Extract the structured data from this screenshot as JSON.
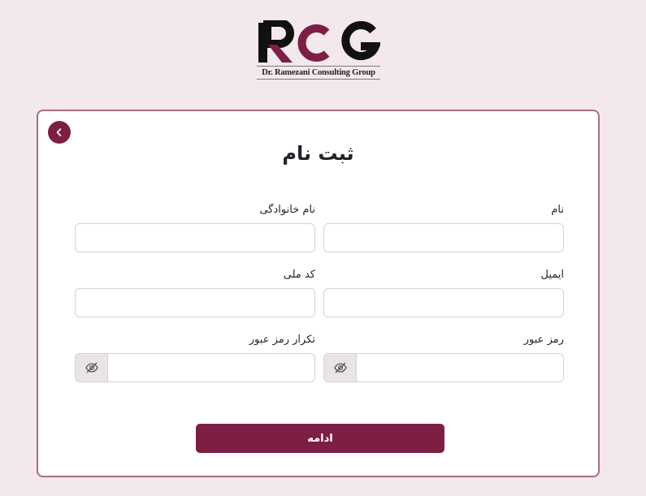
{
  "brand": {
    "logo_text": "RCG",
    "caption": "Dr. Ramezani Consulting Group",
    "colors": {
      "primary": "#7d1f45",
      "dark": "#111111",
      "background": "#f3e8ec"
    }
  },
  "form": {
    "title": "ثبت نام",
    "back_icon": "chevron-left-icon",
    "fields": {
      "first_name": {
        "label": "نام",
        "value": ""
      },
      "last_name": {
        "label": "نام خانوادگی",
        "value": ""
      },
      "email": {
        "label": "ایمیل",
        "value": ""
      },
      "national_code": {
        "label": "کد ملی",
        "value": ""
      },
      "password": {
        "label": "رمز عبور",
        "value": "",
        "toggle_icon": "eye-slash-icon"
      },
      "password_repeat": {
        "label": "تکرار رمز عبور",
        "value": "",
        "toggle_icon": "eye-slash-icon"
      }
    },
    "submit_label": "ادامه"
  }
}
